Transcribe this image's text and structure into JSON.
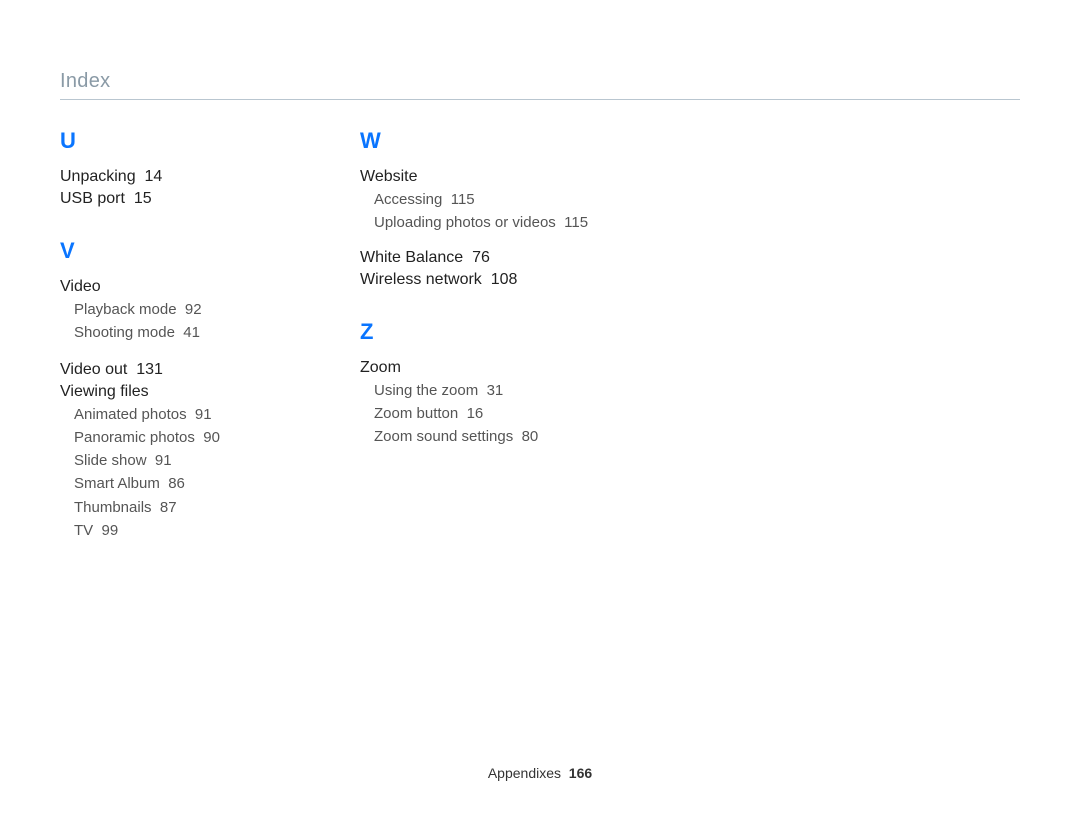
{
  "header": {
    "title": "Index"
  },
  "footer": {
    "section": "Appendixes",
    "page": "166"
  },
  "col1": {
    "letter_u": "U",
    "u_items": [
      {
        "t": "Unpacking",
        "p": "14"
      },
      {
        "t": "USB port",
        "p": "15"
      }
    ],
    "letter_v": "V",
    "v_video": {
      "t": "Video"
    },
    "v_video_subs": [
      {
        "t": "Playback mode",
        "p": "92"
      },
      {
        "t": "Shooting mode",
        "p": "41"
      }
    ],
    "v_video_out": {
      "t": "Video out",
      "p": "131"
    },
    "v_viewing": {
      "t": "Viewing files"
    },
    "v_viewing_subs": [
      {
        "t": "Animated photos",
        "p": "91"
      },
      {
        "t": "Panoramic photos",
        "p": "90"
      },
      {
        "t": "Slide show",
        "p": "91"
      },
      {
        "t": "Smart Album",
        "p": "86"
      },
      {
        "t": "Thumbnails",
        "p": "87"
      },
      {
        "t": "TV",
        "p": "99"
      }
    ]
  },
  "col2": {
    "letter_w": "W",
    "w_website": {
      "t": "Website"
    },
    "w_website_subs": [
      {
        "t": "Accessing",
        "p": "115"
      },
      {
        "t": "Uploading photos or videos",
        "p": "115"
      }
    ],
    "w_white": {
      "t": "White Balance",
      "p": "76"
    },
    "w_wireless": {
      "t": "Wireless network",
      "p": "108"
    },
    "letter_z": "Z",
    "z_zoom": {
      "t": "Zoom"
    },
    "z_zoom_subs": [
      {
        "t": "Using the zoom",
        "p": "31"
      },
      {
        "t": "Zoom button",
        "p": "16"
      },
      {
        "t": "Zoom sound settings",
        "p": "80"
      }
    ]
  }
}
